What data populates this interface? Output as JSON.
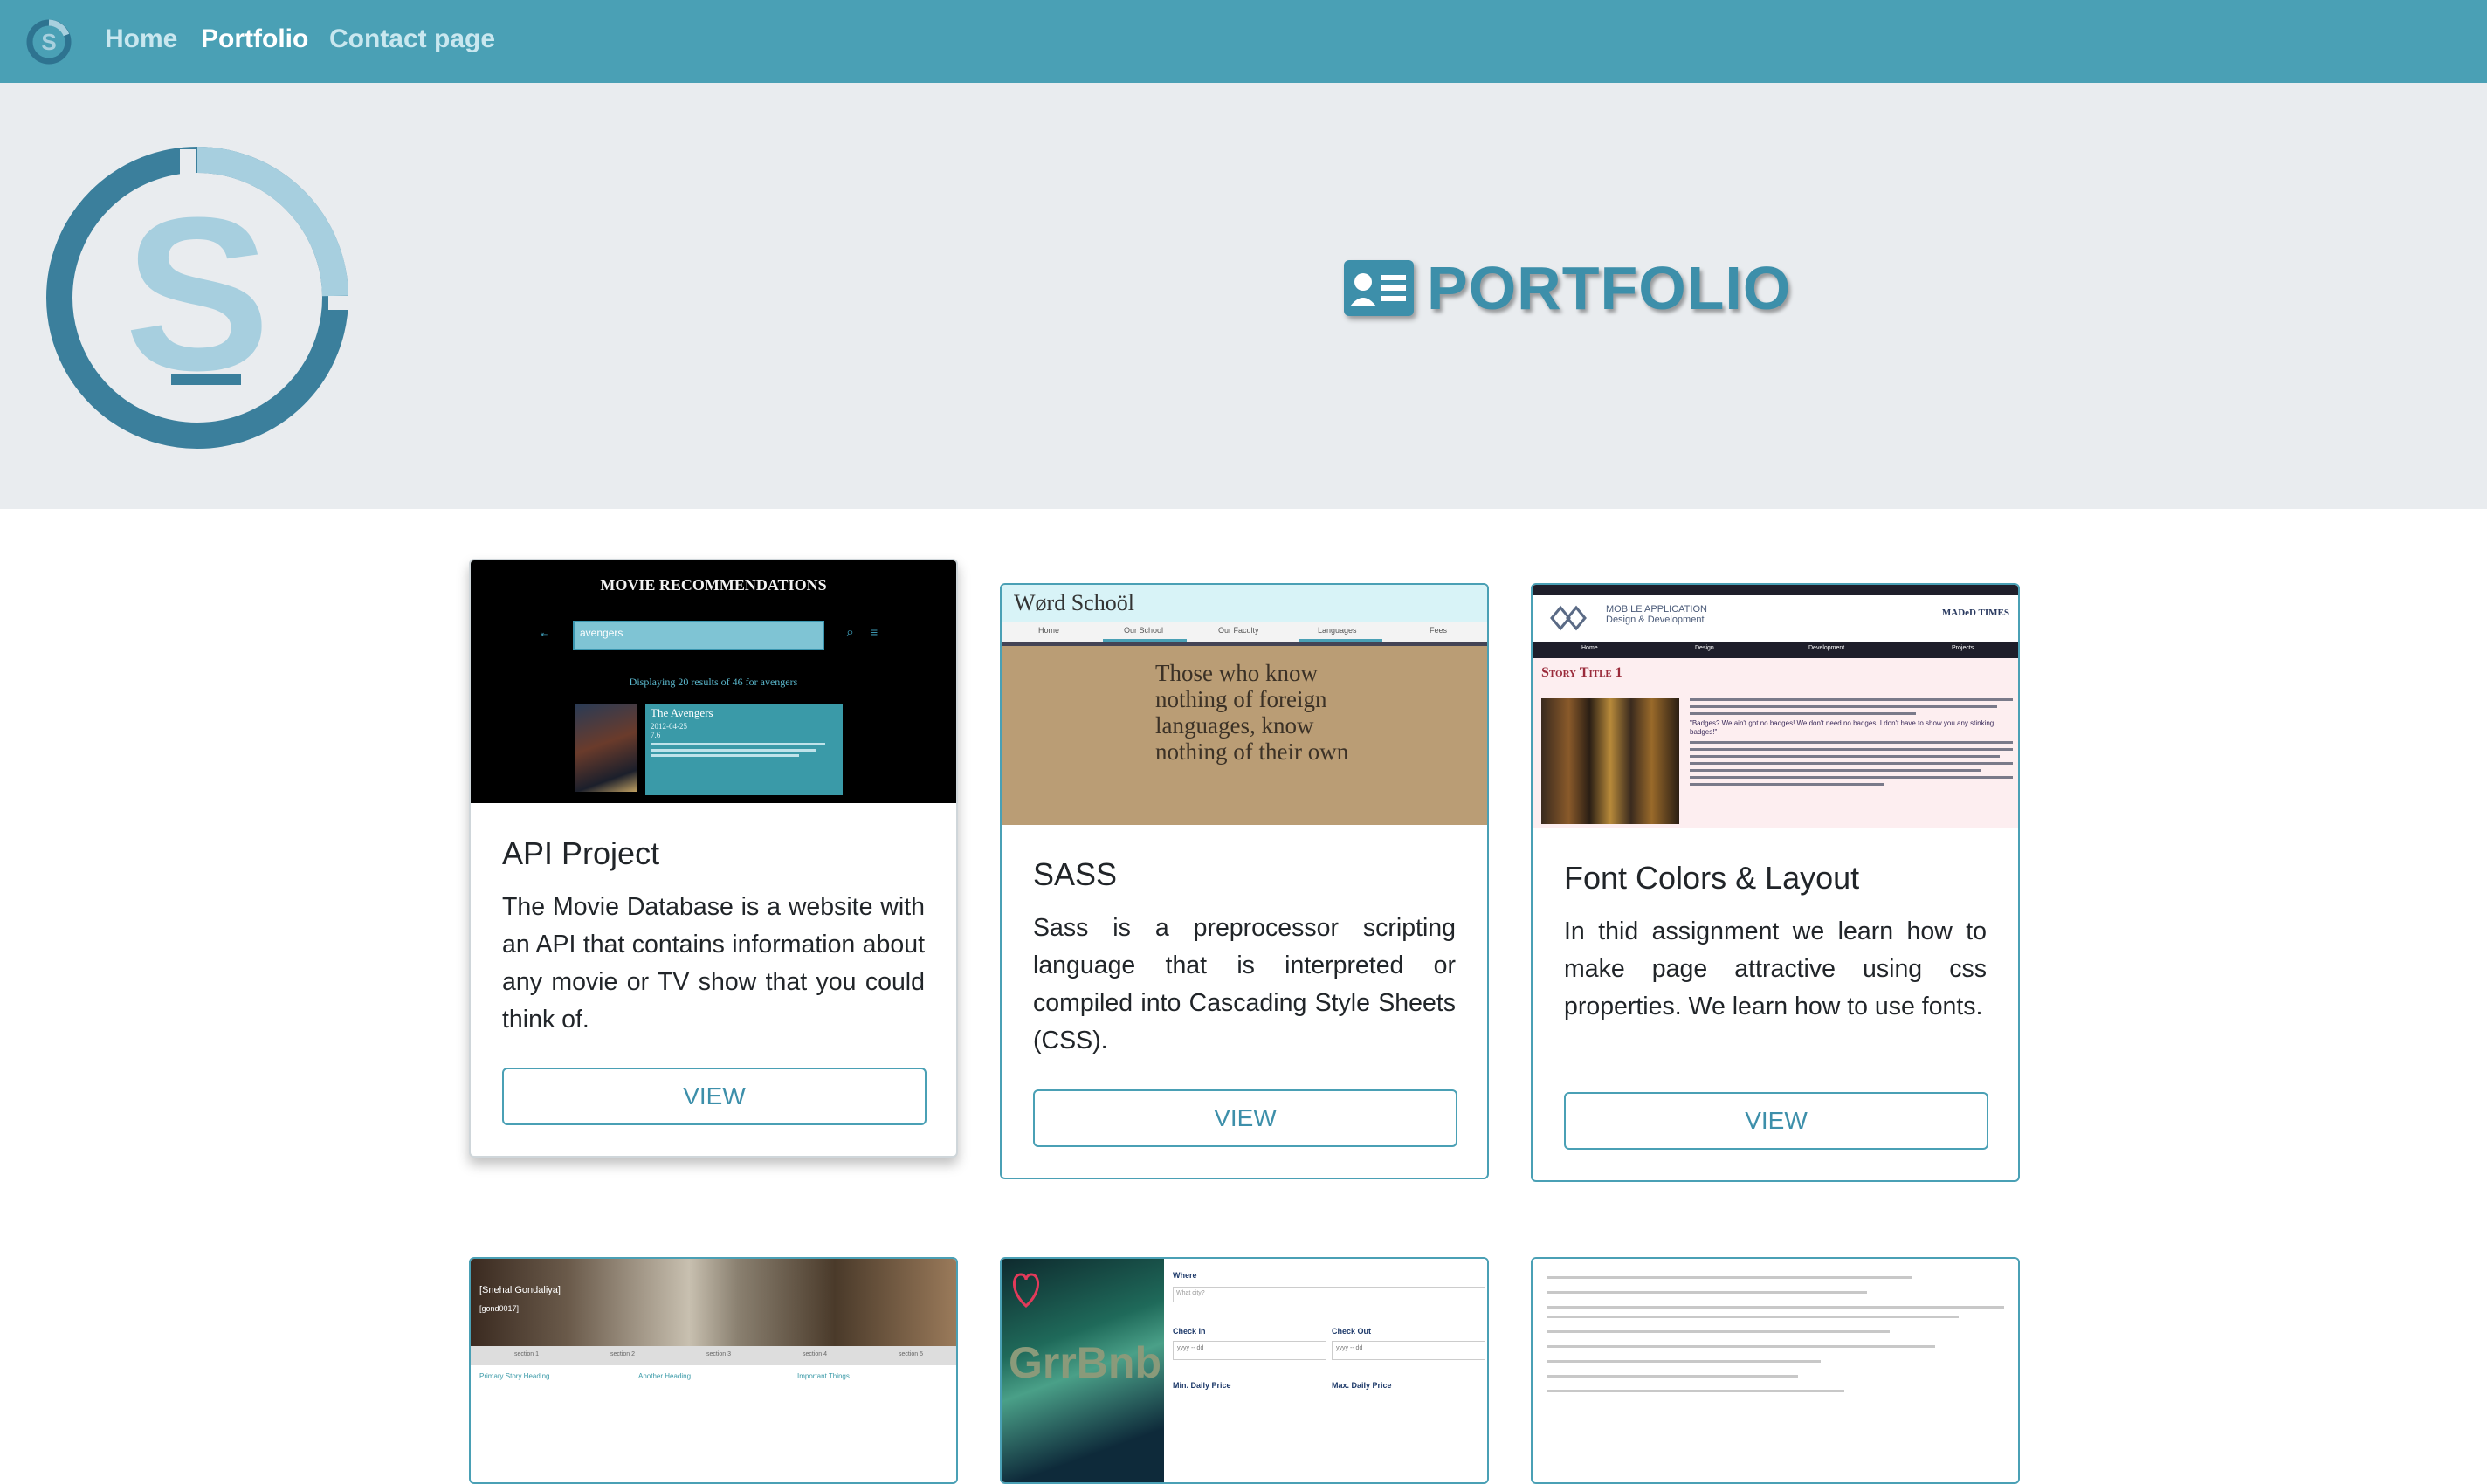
{
  "nav": {
    "links": [
      "Home",
      "Portfolio",
      "Contact page"
    ]
  },
  "hero": {
    "title": "PORTFOLIO"
  },
  "cards": [
    {
      "title": "API Project",
      "text": "The Movie Database is a website with an API that contains information about any movie or TV show that you could think of.",
      "button": "VIEW",
      "thumb": {
        "heading": "MOVIE RECOMMENDATIONS",
        "search_value": "avengers",
        "results": "Displaying 20 results of 46 for avengers",
        "movie_title": "The Avengers",
        "movie_date": "2012-04-25",
        "movie_rating": "7.6"
      }
    },
    {
      "title": "SASS",
      "text": "Sass is a preprocessor scripting language that is interpreted or compiled into Cascading Style Sheets (CSS).",
      "button": "VIEW",
      "thumb": {
        "brand": "Wørd Schoöl",
        "menu": [
          "Home",
          "Our School",
          "Our Faculty",
          "Languages",
          "Fees"
        ],
        "quote": "Those who know nothing of foreign languages, know nothing of their own"
      }
    },
    {
      "title": "Font Colors & Layout",
      "text": "In thid assignment we learn how to make page attractive using css properties. We learn how to use fonts.",
      "button": "VIEW",
      "thumb": {
        "brand_line1": "MOBILE APPLICATION",
        "brand_line2": "Design & Development",
        "times": "MADeD TIMES",
        "menu": [
          "Home",
          "Design",
          "Development",
          "Projects"
        ],
        "story_title": "Story Title 1",
        "badges": "\"Badges? We ain't got no badges! We don't need no badges! I don't have to show you any stinking badges!\""
      }
    },
    {
      "thumb": {
        "name": "[Snehal Gondaliya]",
        "handle": "[gond0017]",
        "sections": [
          "section 1",
          "section 2",
          "section 3",
          "section 4",
          "section 5"
        ],
        "headings": [
          "Primary Story Heading",
          "Another Heading",
          "Important Things"
        ]
      }
    },
    {
      "thumb": {
        "logo": "GrrBnb",
        "where_label": "Where",
        "where_placeholder": "What city?",
        "checkin": "Check In",
        "checkout": "Check Out",
        "date_placeholder": "yyyy -- dd",
        "min_price": "Min. Daily Price",
        "max_price": "Max. Daily Price"
      }
    },
    {
      "thumb": {}
    }
  ],
  "colors": {
    "nav": "#4aa0b5",
    "accent": "#3d8faa",
    "hero_bg": "#e9ecef"
  }
}
